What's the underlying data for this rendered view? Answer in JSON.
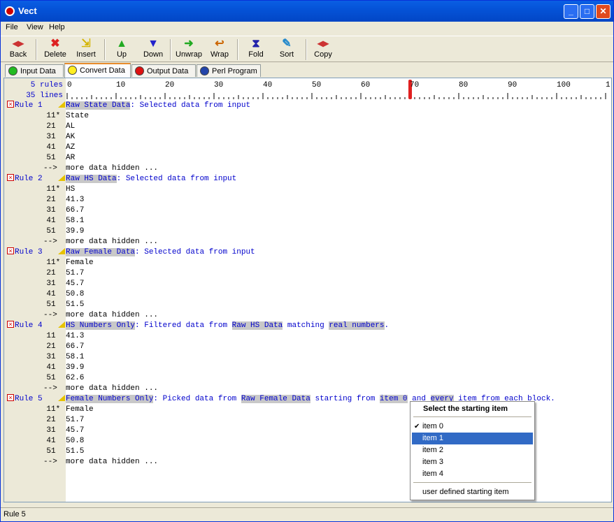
{
  "window": {
    "title": "Vect"
  },
  "menu": [
    "File",
    "View",
    "Help"
  ],
  "toolbar": [
    {
      "label": "Back",
      "icon": "back-icon"
    },
    {
      "label": "Delete",
      "icon": "delete-icon"
    },
    {
      "label": "Insert",
      "icon": "insert-icon"
    },
    {
      "label": "Up",
      "icon": "up-arrow-icon"
    },
    {
      "label": "Down",
      "icon": "down-arrow-icon"
    },
    {
      "label": "Unwrap",
      "icon": "unwrap-icon"
    },
    {
      "label": "Wrap",
      "icon": "wrap-icon"
    },
    {
      "label": "Fold",
      "icon": "fold-icon"
    },
    {
      "label": "Sort",
      "icon": "sort-icon"
    },
    {
      "label": "Copy",
      "icon": "copy-icon"
    }
  ],
  "tabs": [
    {
      "label": "Input Data",
      "color": "#22bb22"
    },
    {
      "label": "Convert Data",
      "color": "#ffee22",
      "active": true
    },
    {
      "label": "Output Data",
      "color": "#dd1111"
    },
    {
      "label": "Perl Program",
      "color": "#2244aa"
    }
  ],
  "ruler": {
    "counts": [
      "5 rules",
      "35 lines"
    ],
    "numbers": [
      "0",
      "10",
      "20",
      "30",
      "40",
      "50",
      "60",
      "70",
      "80",
      "90",
      "100",
      "1"
    ],
    "marker_column": 70
  },
  "rules": [
    {
      "label": "Rule 1",
      "segments": [
        {
          "t": "Raw State Data",
          "hl": true
        },
        {
          "t": ": Selected data from input",
          "hl": false
        }
      ],
      "lines": [
        [
          "1",
          "1*",
          "State"
        ],
        [
          "2",
          "1",
          "AL"
        ],
        [
          "3",
          "1",
          "AK"
        ],
        [
          "4",
          "1",
          "AZ"
        ],
        [
          "5",
          "1",
          "AR"
        ]
      ],
      "more": "more data hidden ..."
    },
    {
      "label": "Rule 2",
      "segments": [
        {
          "t": "Raw HS Data",
          "hl": true
        },
        {
          "t": ": Selected data from input",
          "hl": false
        }
      ],
      "lines": [
        [
          "1",
          "1*",
          "HS"
        ],
        [
          "2",
          "1",
          "41.3"
        ],
        [
          "3",
          "1",
          "66.7"
        ],
        [
          "4",
          "1",
          "58.1"
        ],
        [
          "5",
          "1",
          "39.9"
        ]
      ],
      "more": "more data hidden ..."
    },
    {
      "label": "Rule 3",
      "segments": [
        {
          "t": "Raw Female Data",
          "hl": true
        },
        {
          "t": ": Selected data from input",
          "hl": false
        }
      ],
      "lines": [
        [
          "1",
          "1*",
          "Female"
        ],
        [
          "2",
          "1",
          "51.7"
        ],
        [
          "3",
          "1",
          "45.7"
        ],
        [
          "4",
          "1",
          "50.8"
        ],
        [
          "5",
          "1",
          "51.5"
        ]
      ],
      "more": "more data hidden ..."
    },
    {
      "label": "Rule 4",
      "segments": [
        {
          "t": "HS Numbers Only",
          "hl": true
        },
        {
          "t": ": Filtered data from ",
          "hl": false
        },
        {
          "t": "Raw HS Data",
          "hl": true
        },
        {
          "t": " matching ",
          "hl": false
        },
        {
          "t": "real numbers",
          "hl": true
        },
        {
          "t": ".",
          "hl": false
        }
      ],
      "lines": [
        [
          "1",
          "1",
          "41.3"
        ],
        [
          "2",
          "1",
          "66.7"
        ],
        [
          "3",
          "1",
          "58.1"
        ],
        [
          "4",
          "1",
          "39.9"
        ],
        [
          "5",
          "1",
          "62.6"
        ]
      ],
      "more": "more data hidden ..."
    },
    {
      "label": "Rule 5",
      "segments": [
        {
          "t": "Female Numbers Only",
          "hl": true
        },
        {
          "t": ": Picked data from ",
          "hl": false
        },
        {
          "t": "Raw Female Data",
          "hl": true
        },
        {
          "t": " starting from ",
          "hl": false
        },
        {
          "t": "item 0",
          "hl": true
        },
        {
          "t": " and ",
          "hl": false
        },
        {
          "t": "every",
          "hl": true
        },
        {
          "t": " item from each block.",
          "hl": false
        }
      ],
      "lines": [
        [
          "1",
          "1*",
          "Female"
        ],
        [
          "2",
          "1",
          "51.7"
        ],
        [
          "3",
          "1",
          "45.7"
        ],
        [
          "4",
          "1",
          "50.8"
        ],
        [
          "5",
          "1",
          "51.5"
        ]
      ],
      "more": "more data hidden ..."
    }
  ],
  "arrow_text": "-->",
  "context_menu": {
    "title": "Select the starting item",
    "items": [
      {
        "label": "item 0",
        "checked": true
      },
      {
        "label": "item 1",
        "selected": true
      },
      {
        "label": "item 2"
      },
      {
        "label": "item 3"
      },
      {
        "label": "item 4"
      }
    ],
    "footer": "user defined starting item"
  },
  "status": "Rule 5"
}
